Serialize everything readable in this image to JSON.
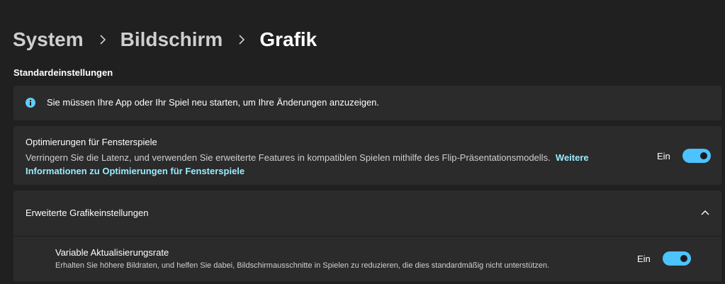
{
  "breadcrumb": {
    "items": [
      "System",
      "Bildschirm"
    ],
    "current": "Grafik"
  },
  "section_title": "Standardeinstellungen",
  "info_banner": {
    "text": "Sie müssen Ihre App oder Ihr Spiel neu starten, um Ihre Änderungen anzuzeigen."
  },
  "windowed_opt": {
    "title": "Optimierungen für Fensterspiele",
    "description": "Verringern Sie die Latenz, und verwenden Sie erweiterte Features in kompatiblen Spielen mithilfe des Flip-Präsentationsmodells.",
    "link": "Weitere Informationen zu Optimierungen für Fensterspiele",
    "toggle_label": "Ein",
    "toggle_on": true
  },
  "advanced": {
    "title": "Erweiterte Grafikeinstellungen",
    "expanded": true,
    "vrr": {
      "title": "Variable Aktualisierungsrate",
      "description": "Erhalten Sie höhere Bildraten, und helfen Sie dabei, Bildschirmausschnitte in Spielen zu reduzieren, die dies standardmäßig nicht unterstützen.",
      "toggle_label": "Ein",
      "toggle_on": true
    }
  },
  "colors": {
    "background": "#202020",
    "card": "#2b2b2b",
    "accent": "#4cc2ff",
    "link": "#99ebff"
  },
  "icons": {
    "info": "info-icon",
    "breadcrumb_separator": "chevron-right-icon",
    "expand": "chevron-up-icon"
  }
}
